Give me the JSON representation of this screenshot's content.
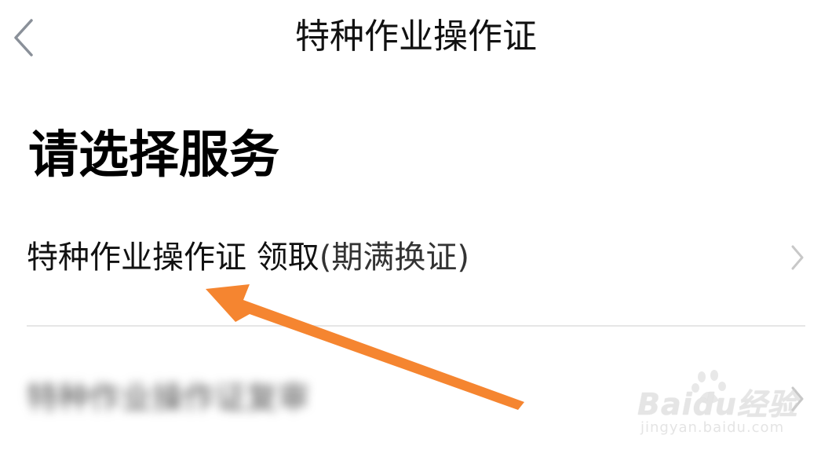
{
  "nav": {
    "title": "特种作业操作证",
    "back_icon": "chevron-left-icon"
  },
  "main": {
    "section_title": "请选择服务",
    "services": [
      {
        "label_main": "特种作业操作证 领取",
        "label_sub": "(期满换证)",
        "chevron_icon": "chevron-right-icon"
      },
      {
        "label": "特种作业操作证复审",
        "chevron_icon": "chevron-right-icon"
      }
    ]
  },
  "watermark": {
    "brand": "Baidu经验",
    "url": "jingyan.baidu.com"
  },
  "colors": {
    "arrow": "#f58530",
    "divider": "#e6e6e6",
    "chevron": "#c8c8c8",
    "back": "#8a9099"
  }
}
